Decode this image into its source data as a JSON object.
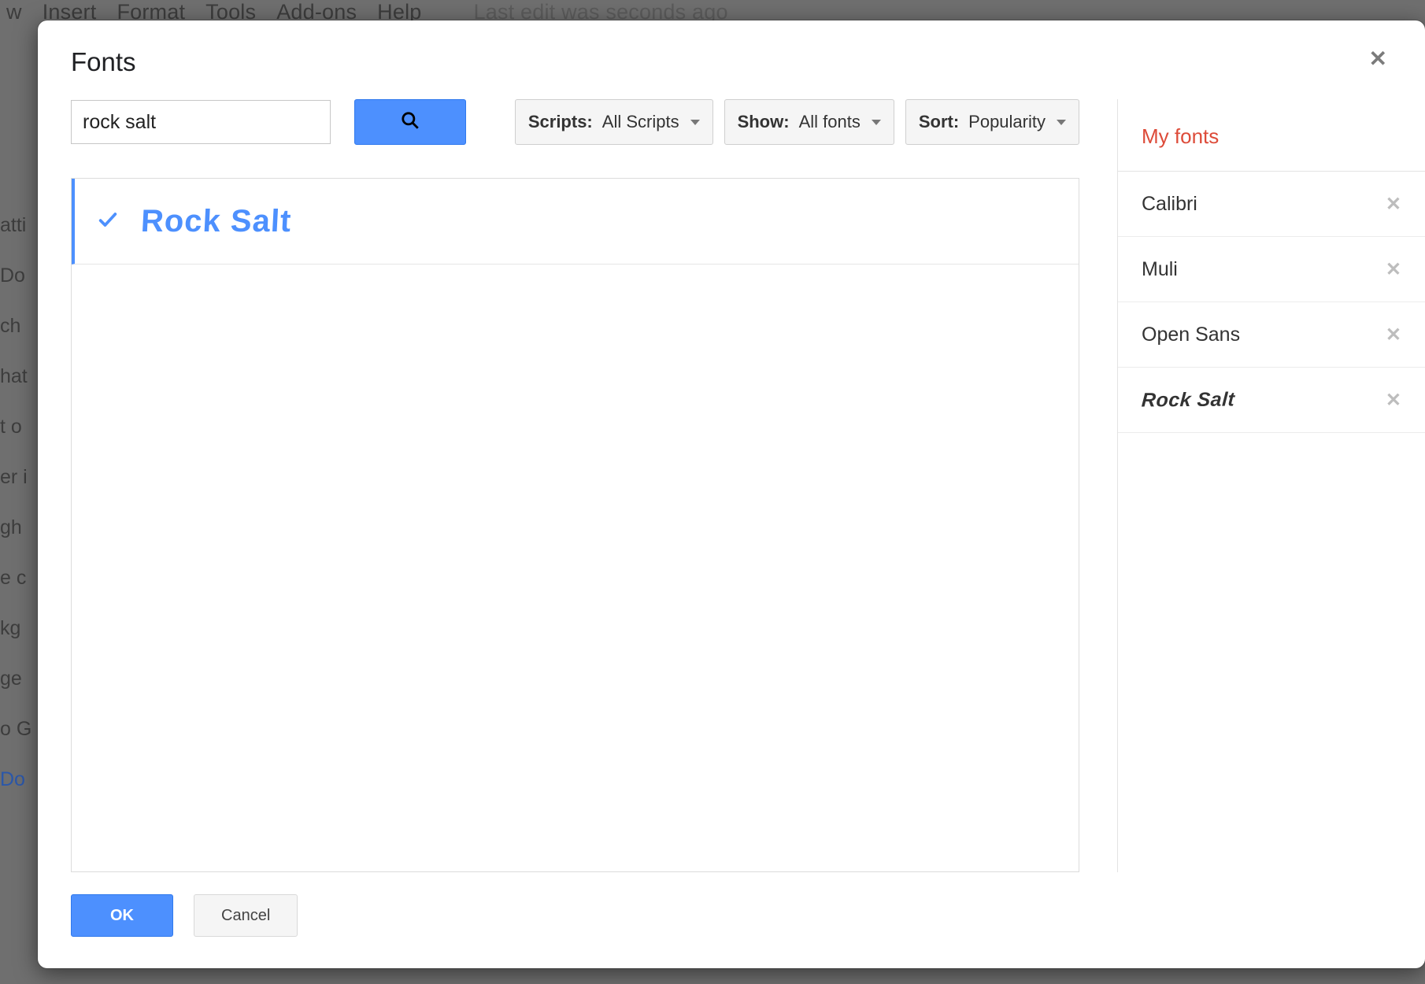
{
  "background": {
    "menus": [
      "w",
      "Insert",
      "Format",
      "Tools",
      "Add-ons",
      "Help"
    ],
    "edit_message": "Last edit was seconds ago",
    "left_fragments": [
      "atti",
      "Do",
      "ch",
      "hat",
      "t o",
      "er i",
      "",
      "gh",
      "e c",
      "kg",
      "ge",
      "o G",
      "Do"
    ]
  },
  "dialog": {
    "title": "Fonts",
    "search_value": "rock salt",
    "filters": {
      "scripts": {
        "prefix": "Scripts:",
        "value": "All Scripts"
      },
      "show": {
        "prefix": "Show:",
        "value": "All fonts"
      },
      "sort": {
        "prefix": "Sort:",
        "value": "Popularity"
      }
    },
    "results": [
      {
        "name": "Rock Salt",
        "selected": true
      }
    ],
    "buttons": {
      "ok": "OK",
      "cancel": "Cancel"
    }
  },
  "my_fonts": {
    "title": "My fonts",
    "items": [
      {
        "name": "Calibri",
        "style_hint": "sans"
      },
      {
        "name": "Muli",
        "style_hint": "sans"
      },
      {
        "name": "Open Sans",
        "style_hint": "sans"
      },
      {
        "name": "Rock Salt",
        "style_hint": "handwriting"
      }
    ]
  }
}
